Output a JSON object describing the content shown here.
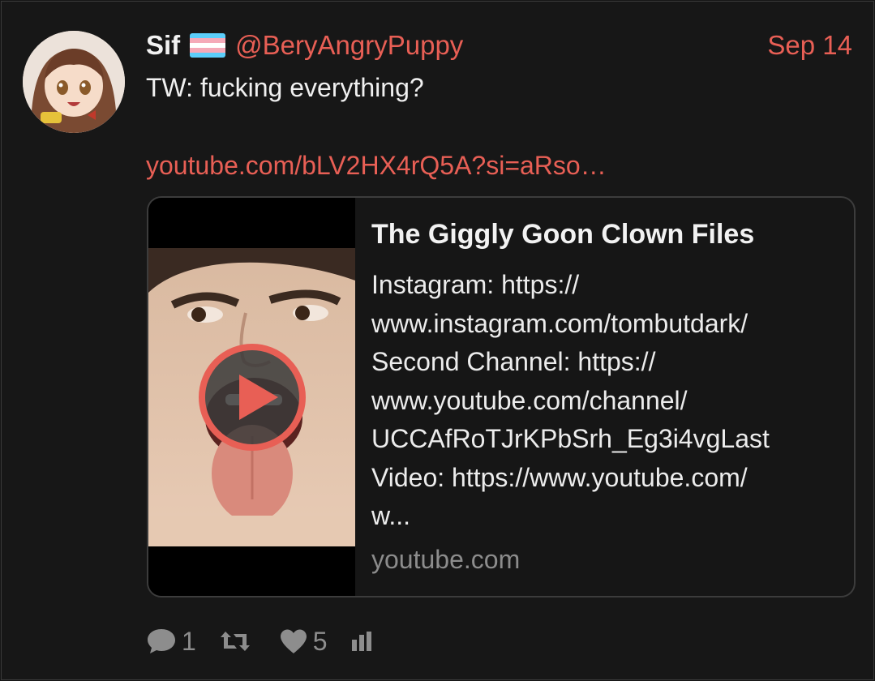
{
  "post": {
    "display_name": "Sif",
    "flag_icon": "transgender-flag",
    "handle": "@BeryAngryPuppy",
    "date": "Sep 14",
    "text": "TW: fucking everything?",
    "link": "youtube.com/bLV2HX4rQ5A?si=aRso…"
  },
  "card": {
    "title": "The Giggly Goon Clown Files",
    "description": "Instagram: https://\nwww.instagram.com/tombutdark/\nSecond Channel: https://\nwww.youtube.com/channel/\nUCCAfRoTJrKPbSrh_Eg3i4vgLast\nVideo: https://www.youtube.com/\nw...",
    "domain": "youtube.com",
    "play_icon": "play-icon"
  },
  "actions": {
    "replies": "1",
    "reposts": "",
    "likes": "5"
  },
  "colors": {
    "accent": "#e85f55",
    "background": "#171717",
    "muted": "#8d8d8d"
  }
}
